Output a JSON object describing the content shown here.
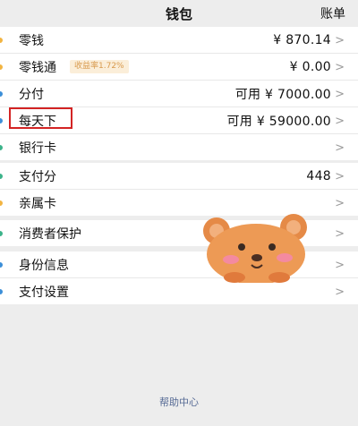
{
  "header": {
    "title": "钱包",
    "bill_label": "账单"
  },
  "group1": [
    {
      "label": "零钱",
      "value": "¥ 870.14",
      "icon": "coin-dot-icon",
      "color": "#f2b441"
    },
    {
      "label": "零钱通",
      "badge": "收益率1.72%",
      "value": "¥ 0.00",
      "icon": "coin-dot-icon",
      "color": "#f2b441"
    },
    {
      "label": "分付",
      "value": "可用 ¥ 7000.00",
      "icon": "pay-dot-icon",
      "color": "#3c8fd8"
    },
    {
      "label": "每天下",
      "value": "可用 ¥ 59000.00",
      "icon": "pay-dot-icon",
      "color": "#3c8fd8"
    },
    {
      "label": "银行卡",
      "value": "",
      "icon": "card-dot-icon",
      "color": "#3cb38a"
    }
  ],
  "group2": [
    {
      "label": "支付分",
      "value": "448",
      "icon": "score-dot-icon",
      "color": "#3cb38a"
    },
    {
      "label": "亲属卡",
      "value": "",
      "icon": "family-dot-icon",
      "color": "#f2b441"
    }
  ],
  "group3": [
    {
      "label": "消费者保护",
      "value": "",
      "icon": "shield-dot-icon",
      "color": "#3cb38a"
    }
  ],
  "group4": [
    {
      "label": "身份信息",
      "value": "",
      "icon": "id-dot-icon",
      "color": "#3c8fd8"
    },
    {
      "label": "支付设置",
      "value": "",
      "icon": "settings-dot-icon",
      "color": "#3c8fd8"
    }
  ],
  "footer": {
    "help_label": "帮助中心"
  },
  "chevron": ">"
}
